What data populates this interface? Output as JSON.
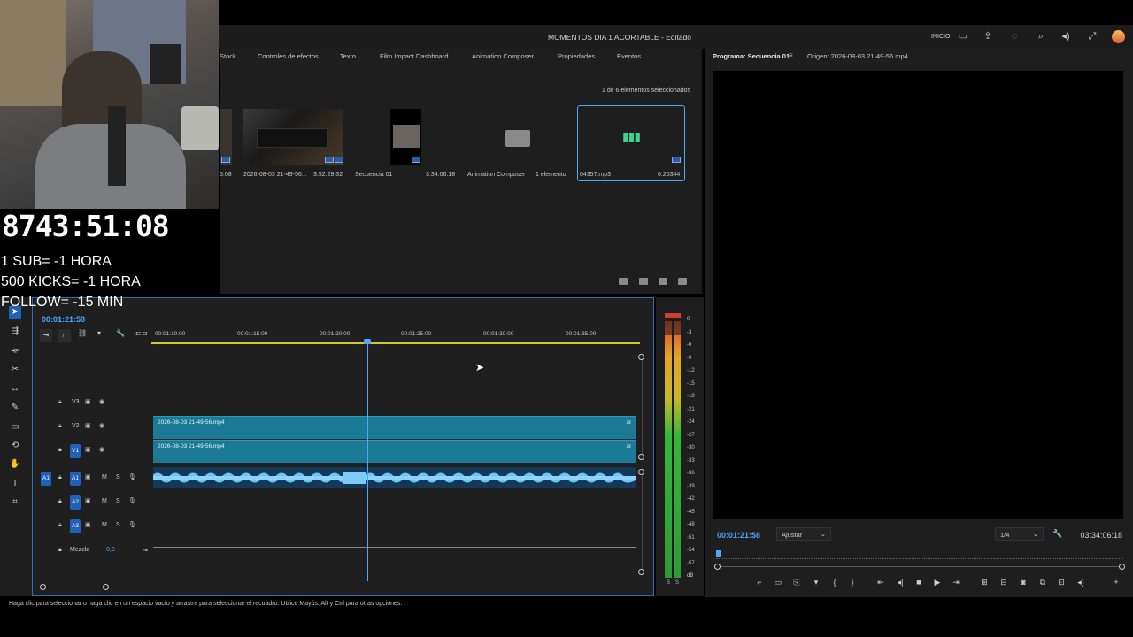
{
  "window": {
    "title": "MOMENTOS DIA 1 ACORTABLE - Editado",
    "workspace_label": "INICIO"
  },
  "project_panel": {
    "tabs": [
      "Stock",
      "Controles de efectos",
      "Texto",
      "Film Impact Dashboard",
      "Animation Composer",
      "Propiedades",
      "Eventos"
    ],
    "selection_info": "1 de 6 elementos seleccionados",
    "items": [
      {
        "name": "",
        "duration": "5:08"
      },
      {
        "name": "2026-08-03 21-49-56...",
        "duration": "3:52:29:32"
      },
      {
        "name": "Secuencia 01",
        "duration": "3:34:06:18"
      },
      {
        "name": "Animation Composer",
        "duration": "1 elemento"
      },
      {
        "name": "04357.mp3",
        "duration": "0:25344"
      }
    ]
  },
  "program_monitor": {
    "tab_program": "Programa: Secuencia 01",
    "tab_source": "Origen: 2026-08-03 21-49-56.mp4",
    "timecode": "00:01:21:58",
    "fit_dropdown": "Ajustar",
    "quality_dropdown": "1/4",
    "duration": "03:34:06:18"
  },
  "timeline": {
    "timecode": "00:01:21:58",
    "ruler_ticks": [
      "00:01:10:00",
      "00:01:15:00",
      "00:01:20:00",
      "00:01:25:00",
      "00:01:30:00",
      "00:01:35:00"
    ],
    "tracks": {
      "v3": "V3",
      "v2": "V2",
      "v1": "V1",
      "a1": "A1",
      "a2": "A2",
      "a3": "A3",
      "mix_label": "Mezcla",
      "mix_value": "0,0",
      "m": "M",
      "s": "S"
    },
    "clip_v2": "2026-08-03 21-49-56.mp4",
    "clip_v1": "2026-08-03 21-49-56.mp4",
    "fx": "fx"
  },
  "meters": {
    "scale": [
      "0",
      "-3",
      "-6",
      "-9",
      "-12",
      "-15",
      "-18",
      "-21",
      "-24",
      "-27",
      "-30",
      "-33",
      "-36",
      "-39",
      "-42",
      "-45",
      "-48",
      "-51",
      "-54",
      "-57",
      "dB"
    ],
    "solo": "S"
  },
  "status_bar": {
    "hint": "Haga clic para seleccionar o haga clic en un espacio vacío y arrastre para seleccionar el recuadro. Utilice Mayús, Alt y Ctrl para otras opciones."
  },
  "stream_overlay": {
    "timer": "8743:51:08",
    "rules": [
      "1 SUB= -1 HORA",
      "500 KICKS= -1 HORA",
      "FOLLOW= -15 MIN"
    ]
  },
  "colors": {
    "accent": "#4aa8ff",
    "clip_video": "#1b7a96",
    "track_target": "#2060b8",
    "work_area": "#d4c52a"
  }
}
